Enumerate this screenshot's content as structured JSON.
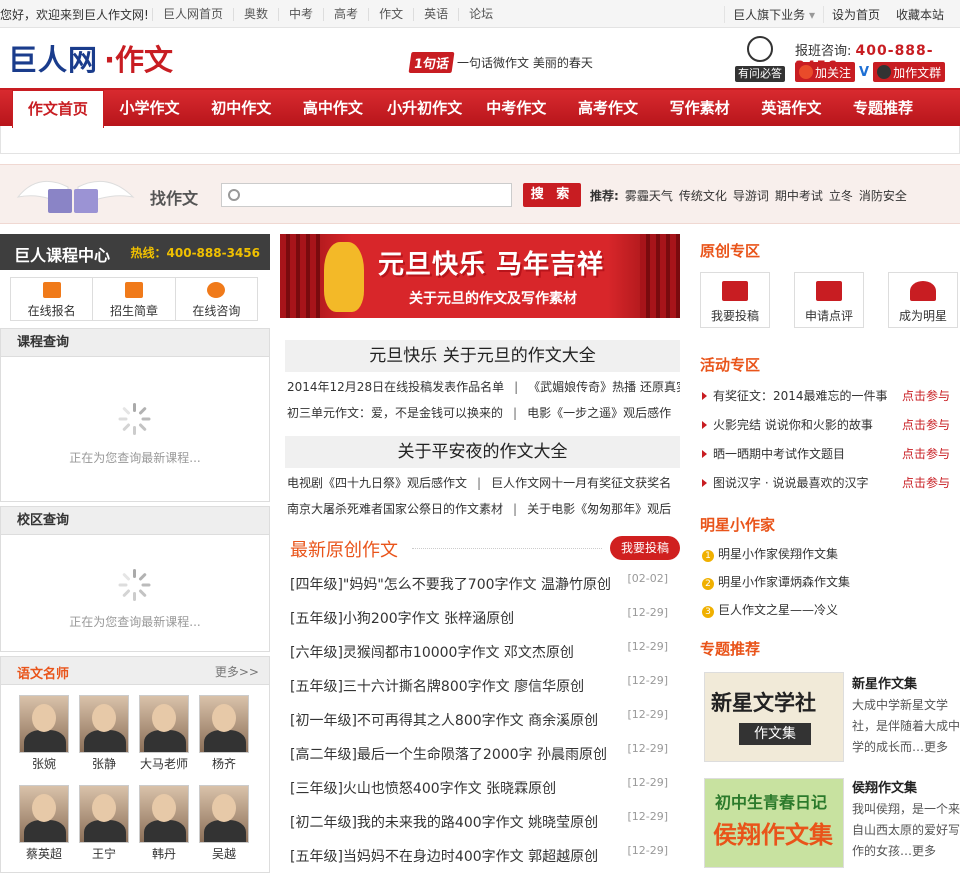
{
  "topbar": {
    "welcome": "您好，欢迎来到巨人作文网!",
    "links": [
      "巨人网首页",
      "奥数",
      "中考",
      "高考",
      "作文",
      "英语",
      "论坛"
    ],
    "business": "巨人旗下业务",
    "set_home": "设为首页",
    "favorite": "收藏本站"
  },
  "header": {
    "logo_main": "巨人网",
    "logo_sub": "·作文",
    "slogan_badge": "1句话",
    "slogan_text": "一句话微作文  美丽的春天",
    "ask_label": "有问必答",
    "hotline_label": "报班咨询:",
    "hotline_number": "400-888-3456",
    "weibo_follow": "加关注",
    "qq_group": "加作文群"
  },
  "mainnav": {
    "items": [
      "作文首页",
      "小学作文",
      "初中作文",
      "高中作文",
      "小升初作文",
      "中考作文",
      "高考作文",
      "写作素材",
      "英语作文",
      "专题推荐"
    ]
  },
  "search": {
    "label": "找作文",
    "button": "搜 索",
    "rec_label": "推荐:",
    "rec_items": [
      "雾霾天气",
      "传统文化",
      "导游词",
      "期中考试",
      "立冬",
      "消防安全"
    ]
  },
  "left": {
    "center_title": "巨人课程中心",
    "hotline": "热线：400-888-3456",
    "icons": [
      "在线报名",
      "招生简章",
      "在线咨询"
    ],
    "course_query": "课程查询",
    "loading_msg": "正在为您查询最新课程...",
    "campus_query": "校区查询",
    "teachers_title": "语文名师",
    "more": "更多>>",
    "teachers": [
      "张婉",
      "张静",
      "大马老师",
      "杨齐",
      "蔡英超",
      "王宁",
      "韩丹",
      "吴越"
    ]
  },
  "middle": {
    "banner_title": "元旦快乐 马年吉祥",
    "banner_sub": "关于元旦的作文及写作素材",
    "block1_title": "元旦快乐  关于元旦的作文大全",
    "block1_lines": [
      [
        "2014年12月28日在线投稿发表作品名单",
        "《武媚娘传奇》热播  还原真实"
      ],
      [
        "初三单元作文：爱，不是金钱可以换来的",
        "电影《一步之遥》观后感作"
      ]
    ],
    "block2_title": "关于平安夜的作文大全",
    "block2_lines": [
      [
        "电视剧《四十九日祭》观后感作文",
        "巨人作文网十一月有奖征文获奖名"
      ],
      [
        "南京大屠杀死难者国家公祭日的作文素材",
        "关于电影《匆匆那年》观后"
      ]
    ],
    "latest_title": "最新原创作文",
    "submit_btn": "我要投稿",
    "articles": [
      {
        "title": "[四年级]\"妈妈\"怎么不要我了700字作文 温瀞竹原创",
        "date": "[02-02]"
      },
      {
        "title": "[五年级]小狗200字作文 张梓涵原创",
        "date": "[12-29]"
      },
      {
        "title": "[六年级]灵猴闯都市10000字作文 邓文杰原创",
        "date": "[12-29]"
      },
      {
        "title": "[五年级]三十六计撕名牌800字作文 廖信华原创",
        "date": "[12-29]"
      },
      {
        "title": "[初一年级]不可再得其之人800字作文 商余溪原创",
        "date": "[12-29]"
      },
      {
        "title": "[高二年级]最后一个生命陨落了2000字 孙晨雨原创",
        "date": "[12-29]"
      },
      {
        "title": "[三年级]火山也愤怒400字作文 张晓霖原创",
        "date": "[12-29]"
      },
      {
        "title": "[初二年级]我的未来我的路400字作文 姚晓莹原创",
        "date": "[12-29]"
      },
      {
        "title": "[五年级]当妈妈不在身边时400字作文 郭超越原创",
        "date": "[12-29]"
      }
    ]
  },
  "right": {
    "original_title": "原创专区",
    "original_boxes": [
      "我要投稿",
      "申请点评",
      "成为明星"
    ],
    "activity_title": "活动专区",
    "activities": [
      {
        "text": "有奖征文：2014最难忘的一件事",
        "go": "点击参与"
      },
      {
        "text": "火影完结 说说你和火影的故事",
        "go": "点击参与"
      },
      {
        "text": "晒一晒期中考试作文题目",
        "go": "点击参与"
      },
      {
        "text": "图说汉字 · 说说最喜欢的汉字",
        "go": "点击参与"
      }
    ],
    "star_title": "明星小作家",
    "stars": [
      "明星小作家侯翔作文集",
      "明星小作家谭炳森作文集",
      "巨人作文之星——冷义"
    ],
    "topic_title": "专题推荐",
    "topics": [
      {
        "img_big": "新星文学社",
        "img_sub": "作文集",
        "name": "新星作文集",
        "desc": "大成中学新星文学社，是伴随着大成中学的成长而…更多"
      },
      {
        "img_big": "初中生青春日记",
        "img_sub": "侯翔作文集",
        "name": "侯翔作文集",
        "desc": "我叫侯翔，是一个来自山西太原的爱好写作的女孩…更多"
      }
    ]
  },
  "colors": {
    "brand_red": "#c81d22",
    "accent_orange": "#e9541a",
    "logo_blue": "#1a3c8c"
  }
}
